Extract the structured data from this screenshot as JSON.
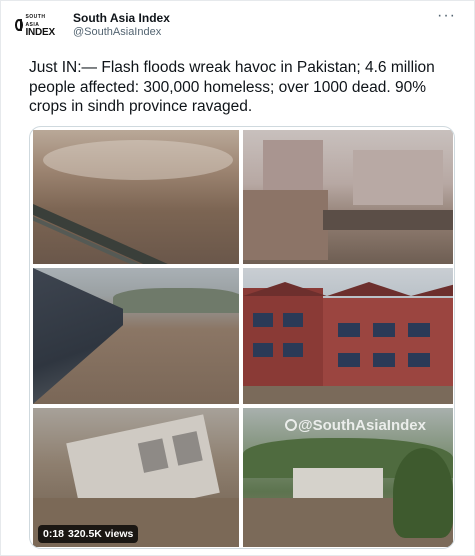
{
  "account": {
    "display_name": "South Asia Index",
    "handle": "@SouthAsiaIndex",
    "avatar_small": "SOUTH ASIA",
    "avatar_big": "INDEX"
  },
  "menu": {
    "icon": "more-icon",
    "glyph": "···"
  },
  "tweet": {
    "text": "Just IN:— Flash floods wreak havoc in Pakistan; 4.6 million people affected: 300,000 homeless; over 1000 dead. 90% crops in sindh province ravaged."
  },
  "media": {
    "watermark": "@SouthAsiaIndex",
    "duration": "0:18",
    "views": "320.5K views"
  },
  "colors": {
    "text": "#0f1419",
    "secondary": "#536471",
    "border": "#cfd9de"
  }
}
